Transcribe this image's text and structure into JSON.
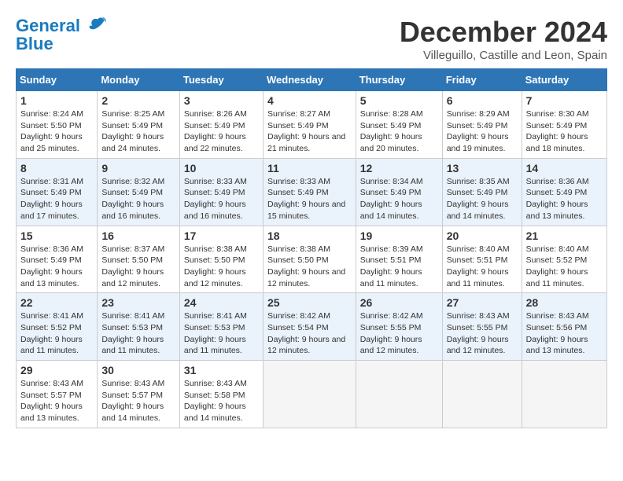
{
  "logo": {
    "line1": "General",
    "line2": "Blue"
  },
  "title": "December 2024",
  "location": "Villeguillo, Castille and Leon, Spain",
  "header": {
    "days": [
      "Sunday",
      "Monday",
      "Tuesday",
      "Wednesday",
      "Thursday",
      "Friday",
      "Saturday"
    ]
  },
  "weeks": [
    [
      {
        "day": "1",
        "sunrise": "8:24 AM",
        "sunset": "5:50 PM",
        "daylight": "9 hours and 25 minutes."
      },
      {
        "day": "2",
        "sunrise": "8:25 AM",
        "sunset": "5:49 PM",
        "daylight": "9 hours and 24 minutes."
      },
      {
        "day": "3",
        "sunrise": "8:26 AM",
        "sunset": "5:49 PM",
        "daylight": "9 hours and 22 minutes."
      },
      {
        "day": "4",
        "sunrise": "8:27 AM",
        "sunset": "5:49 PM",
        "daylight": "9 hours and 21 minutes."
      },
      {
        "day": "5",
        "sunrise": "8:28 AM",
        "sunset": "5:49 PM",
        "daylight": "9 hours and 20 minutes."
      },
      {
        "day": "6",
        "sunrise": "8:29 AM",
        "sunset": "5:49 PM",
        "daylight": "9 hours and 19 minutes."
      },
      {
        "day": "7",
        "sunrise": "8:30 AM",
        "sunset": "5:49 PM",
        "daylight": "9 hours and 18 minutes."
      }
    ],
    [
      {
        "day": "8",
        "sunrise": "8:31 AM",
        "sunset": "5:49 PM",
        "daylight": "9 hours and 17 minutes."
      },
      {
        "day": "9",
        "sunrise": "8:32 AM",
        "sunset": "5:49 PM",
        "daylight": "9 hours and 16 minutes."
      },
      {
        "day": "10",
        "sunrise": "8:33 AM",
        "sunset": "5:49 PM",
        "daylight": "9 hours and 16 minutes."
      },
      {
        "day": "11",
        "sunrise": "8:33 AM",
        "sunset": "5:49 PM",
        "daylight": "9 hours and 15 minutes."
      },
      {
        "day": "12",
        "sunrise": "8:34 AM",
        "sunset": "5:49 PM",
        "daylight": "9 hours and 14 minutes."
      },
      {
        "day": "13",
        "sunrise": "8:35 AM",
        "sunset": "5:49 PM",
        "daylight": "9 hours and 14 minutes."
      },
      {
        "day": "14",
        "sunrise": "8:36 AM",
        "sunset": "5:49 PM",
        "daylight": "9 hours and 13 minutes."
      }
    ],
    [
      {
        "day": "15",
        "sunrise": "8:36 AM",
        "sunset": "5:49 PM",
        "daylight": "9 hours and 13 minutes."
      },
      {
        "day": "16",
        "sunrise": "8:37 AM",
        "sunset": "5:50 PM",
        "daylight": "9 hours and 12 minutes."
      },
      {
        "day": "17",
        "sunrise": "8:38 AM",
        "sunset": "5:50 PM",
        "daylight": "9 hours and 12 minutes."
      },
      {
        "day": "18",
        "sunrise": "8:38 AM",
        "sunset": "5:50 PM",
        "daylight": "9 hours and 12 minutes."
      },
      {
        "day": "19",
        "sunrise": "8:39 AM",
        "sunset": "5:51 PM",
        "daylight": "9 hours and 11 minutes."
      },
      {
        "day": "20",
        "sunrise": "8:40 AM",
        "sunset": "5:51 PM",
        "daylight": "9 hours and 11 minutes."
      },
      {
        "day": "21",
        "sunrise": "8:40 AM",
        "sunset": "5:52 PM",
        "daylight": "9 hours and 11 minutes."
      }
    ],
    [
      {
        "day": "22",
        "sunrise": "8:41 AM",
        "sunset": "5:52 PM",
        "daylight": "9 hours and 11 minutes."
      },
      {
        "day": "23",
        "sunrise": "8:41 AM",
        "sunset": "5:53 PM",
        "daylight": "9 hours and 11 minutes."
      },
      {
        "day": "24",
        "sunrise": "8:41 AM",
        "sunset": "5:53 PM",
        "daylight": "9 hours and 11 minutes."
      },
      {
        "day": "25",
        "sunrise": "8:42 AM",
        "sunset": "5:54 PM",
        "daylight": "9 hours and 12 minutes."
      },
      {
        "day": "26",
        "sunrise": "8:42 AM",
        "sunset": "5:55 PM",
        "daylight": "9 hours and 12 minutes."
      },
      {
        "day": "27",
        "sunrise": "8:43 AM",
        "sunset": "5:55 PM",
        "daylight": "9 hours and 12 minutes."
      },
      {
        "day": "28",
        "sunrise": "8:43 AM",
        "sunset": "5:56 PM",
        "daylight": "9 hours and 13 minutes."
      }
    ],
    [
      {
        "day": "29",
        "sunrise": "8:43 AM",
        "sunset": "5:57 PM",
        "daylight": "9 hours and 13 minutes."
      },
      {
        "day": "30",
        "sunrise": "8:43 AM",
        "sunset": "5:57 PM",
        "daylight": "9 hours and 14 minutes."
      },
      {
        "day": "31",
        "sunrise": "8:43 AM",
        "sunset": "5:58 PM",
        "daylight": "9 hours and 14 minutes."
      },
      null,
      null,
      null,
      null
    ]
  ]
}
